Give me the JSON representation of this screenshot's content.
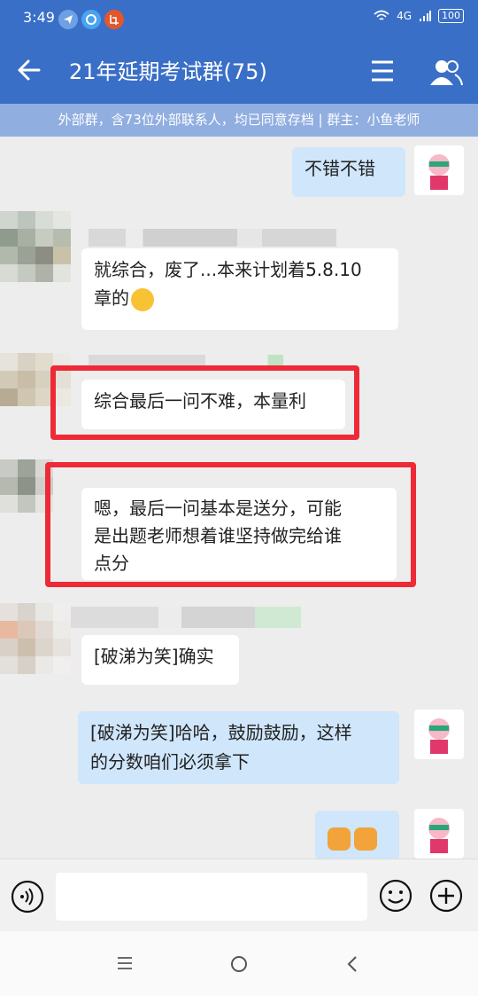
{
  "status_bar": {
    "time": "3:49",
    "network": "4G",
    "battery": "100"
  },
  "header": {
    "title": "21年延期考试群(75)",
    "back_icon": "arrow-left-icon",
    "menu_icon": "menu-icon",
    "members_icon": "group-members-icon"
  },
  "notice": {
    "text": "外部群，含73位外部联系人，均已同意存档 | 群主：小鱼老师"
  },
  "messages": [
    {
      "side": "right",
      "text": "不错不错"
    },
    {
      "side": "left",
      "line1": "就综合，废了...本来计划着5.8.10",
      "line2": "章的"
    },
    {
      "side": "left",
      "text": "综合最后一问不难，本量利"
    },
    {
      "side": "left",
      "line1": "嗯，最后一问基本是送分，可能",
      "line2": "是出题老师想着谁坚持做完给谁",
      "line3": "点分"
    },
    {
      "side": "left",
      "text": "[破涕为笑]确实"
    },
    {
      "side": "right",
      "line1": "[破涕为笑]哈哈，鼓励鼓励，这样",
      "line2": "的分数咱们必须拿下"
    },
    {
      "side": "right",
      "emoji": "fist-emoji-x2"
    }
  ],
  "input_bar": {
    "placeholder": ""
  },
  "colors": {
    "header": "#3a6fc7",
    "notice": "#90aee0",
    "highlight": "#ee2a37",
    "bubble_self": "#cfe6fb"
  }
}
